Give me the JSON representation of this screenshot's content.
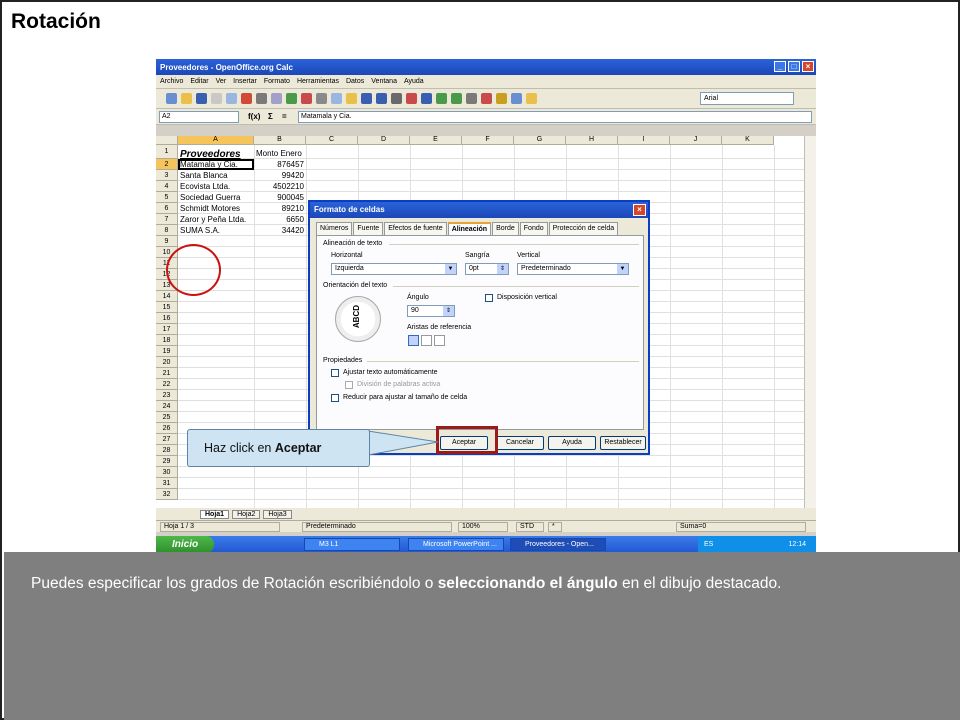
{
  "slide": {
    "title": "Rotación",
    "footer": {
      "text_a": "Puedes especificar los grados de Rotación escribiéndolo o ",
      "text_b": "seleccionando el ángulo",
      "text_c": " en el dibujo destacado."
    }
  },
  "app": {
    "window_title": "Proveedores - OpenOffice.org Calc",
    "menus": [
      "Archivo",
      "Editar",
      "Ver",
      "Insertar",
      "Formato",
      "Herramientas",
      "Datos",
      "Ventana",
      "Ayuda"
    ],
    "font_name": "Arial",
    "name_box": "A2",
    "formula_symbols": {
      "fx": "f(x)",
      "sum": "Σ",
      "eq": "="
    },
    "formula_value": "Matamala y Cia.",
    "columns": [
      "A",
      "B",
      "C",
      "D",
      "E",
      "F",
      "G",
      "H",
      "I",
      "J",
      "K"
    ],
    "rows": [
      "1",
      "2",
      "3",
      "4",
      "5",
      "6",
      "7",
      "8",
      "9",
      "10",
      "11",
      "12",
      "13",
      "14",
      "15",
      "16",
      "17",
      "18",
      "19",
      "20",
      "21",
      "22",
      "23",
      "24",
      "25",
      "26",
      "27",
      "28",
      "29",
      "30",
      "31",
      "32"
    ],
    "header_cells": {
      "a1": "Proveedores",
      "b1": "Monto Enero"
    },
    "data_rows": [
      {
        "name": "Matamala y Cia.",
        "value": "876457"
      },
      {
        "name": "Santa Blanca",
        "value": "99420"
      },
      {
        "name": "Ecovista Ltda.",
        "value": "4502210"
      },
      {
        "name": "Sociedad Guerra",
        "value": "900045"
      },
      {
        "name": "Schmidt Motores",
        "value": "89210"
      },
      {
        "name": "Zaror y Peña Ltda.",
        "value": "6650"
      },
      {
        "name": "SUMA S.A.",
        "value": "34420"
      }
    ],
    "sheet_tabs": [
      "Hoja1",
      "Hoja2",
      "Hoja3"
    ],
    "status": {
      "sheet": "Hoja 1 / 3",
      "style": "Predeterminado",
      "zoom": "100%",
      "mode": "STD",
      "star": "*",
      "sum": "Suma=0"
    },
    "taskbar": {
      "start": "Inicio",
      "tasks": [
        "M3 L1",
        "Microsoft PowerPoint ...",
        "Proveedores - Open..."
      ],
      "lang": "ES",
      "clock": "12:14"
    }
  },
  "dialog": {
    "title": "Formato de celdas",
    "tabs": [
      "Números",
      "Fuente",
      "Efectos de fuente",
      "Alineación",
      "Borde",
      "Fondo",
      "Protección de celda"
    ],
    "active_tab": "Alineación",
    "alignment_group": "Alineación de texto",
    "horizontal_label": "Horizontal",
    "horizontal_value": "Izquierda",
    "indent_label": "Sangría",
    "indent_value": "0pt",
    "vertical_label": "Vertical",
    "vertical_value": "Predeterminado",
    "orientation_group": "Orientación del texto",
    "dial_text": "ABCD",
    "angle_label": "Ángulo",
    "angle_value": "90",
    "vertical_stack_label": "Disposición vertical",
    "reference_edges_label": "Aristas de referencia",
    "properties_group": "Propiedades",
    "wrap_label": "Ajustar texto automáticamente",
    "hyphen_label": "División de palabras activa",
    "shrink_label": "Reducir para ajustar al tamaño de celda",
    "buttons": {
      "ok": "Aceptar",
      "cancel": "Cancelar",
      "help": "Ayuda",
      "reset": "Restablecer"
    }
  },
  "callout": {
    "text": "Haz click en ",
    "bold": "Aceptar"
  }
}
